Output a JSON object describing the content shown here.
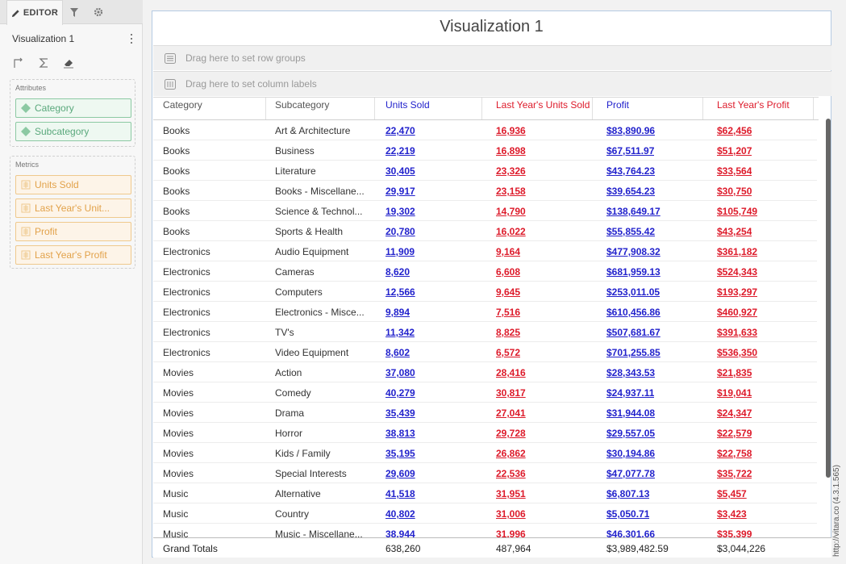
{
  "panel": {
    "tabs": {
      "editor": "EDITOR",
      "filter_icon": "funnel-icon",
      "settings_icon": "gear-icon"
    },
    "visualization_name": "Visualization 1",
    "toolbar_icons": [
      "swap-axes-icon",
      "sigma-icon",
      "eraser-icon"
    ],
    "attributes": {
      "title": "Attributes",
      "items": [
        "Category",
        "Subcategory"
      ]
    },
    "metrics": {
      "title": "Metrics",
      "items": [
        "Units Sold",
        "Last Year's Unit...",
        "Profit",
        "Last Year's Profit"
      ]
    },
    "colors": {
      "attribute": "#5aa87c",
      "metric": "#e2a24a"
    }
  },
  "viz": {
    "title": "Visualization 1",
    "drop_rows": "Drag here to set row groups",
    "drop_cols": "Drag here to set column labels",
    "columns": [
      "Category",
      "Subcategory",
      "Units Sold",
      "Last Year's Units Sold",
      "Profit",
      "Last Year's Profit"
    ],
    "colors": {
      "units": "#2222cc",
      "last_year": "#dd1a2a"
    },
    "rows": [
      [
        "Books",
        "Art & Architecture",
        "22,470",
        "16,936",
        "$83,890.96",
        "$62,456"
      ],
      [
        "Books",
        "Business",
        "22,219",
        "16,898",
        "$67,511.97",
        "$51,207"
      ],
      [
        "Books",
        "Literature",
        "30,405",
        "23,326",
        "$43,764.23",
        "$33,564"
      ],
      [
        "Books",
        "Books - Miscellane...",
        "29,917",
        "23,158",
        "$39,654.23",
        "$30,750"
      ],
      [
        "Books",
        "Science & Technol...",
        "19,302",
        "14,790",
        "$138,649.17",
        "$105,749"
      ],
      [
        "Books",
        "Sports & Health",
        "20,780",
        "16,022",
        "$55,855.42",
        "$43,254"
      ],
      [
        "Electronics",
        "Audio Equipment",
        "11,909",
        "9,164",
        "$477,908.32",
        "$361,182"
      ],
      [
        "Electronics",
        "Cameras",
        "8,620",
        "6,608",
        "$681,959.13",
        "$524,343"
      ],
      [
        "Electronics",
        "Computers",
        "12,566",
        "9,645",
        "$253,011.05",
        "$193,297"
      ],
      [
        "Electronics",
        "Electronics - Misce...",
        "9,894",
        "7,516",
        "$610,456.86",
        "$460,927"
      ],
      [
        "Electronics",
        "TV's",
        "11,342",
        "8,825",
        "$507,681.67",
        "$391,633"
      ],
      [
        "Electronics",
        "Video Equipment",
        "8,602",
        "6,572",
        "$701,255.85",
        "$536,350"
      ],
      [
        "Movies",
        "Action",
        "37,080",
        "28,416",
        "$28,343.53",
        "$21,835"
      ],
      [
        "Movies",
        "Comedy",
        "40,279",
        "30,817",
        "$24,937.11",
        "$19,041"
      ],
      [
        "Movies",
        "Drama",
        "35,439",
        "27,041",
        "$31,944.08",
        "$24,347"
      ],
      [
        "Movies",
        "Horror",
        "38,813",
        "29,728",
        "$29,557.05",
        "$22,579"
      ],
      [
        "Movies",
        "Kids / Family",
        "35,195",
        "26,862",
        "$30,194.86",
        "$22,758"
      ],
      [
        "Movies",
        "Special Interests",
        "29,609",
        "22,536",
        "$47,077.78",
        "$35,722"
      ],
      [
        "Music",
        "Alternative",
        "41,518",
        "31,951",
        "$6,807.13",
        "$5,457"
      ],
      [
        "Music",
        "Country",
        "40,802",
        "31,006",
        "$5,050.71",
        "$3,423"
      ],
      [
        "Music",
        "Music - Miscellane...",
        "38,944",
        "31,996",
        "$46,301.66",
        "$35,399"
      ]
    ],
    "totals": [
      "Grand Totals",
      "",
      "638,260",
      "487,964",
      "$3,989,482.59",
      "$3,044,226"
    ]
  },
  "watermark": "http://vitara.co (4.3.1.565)"
}
